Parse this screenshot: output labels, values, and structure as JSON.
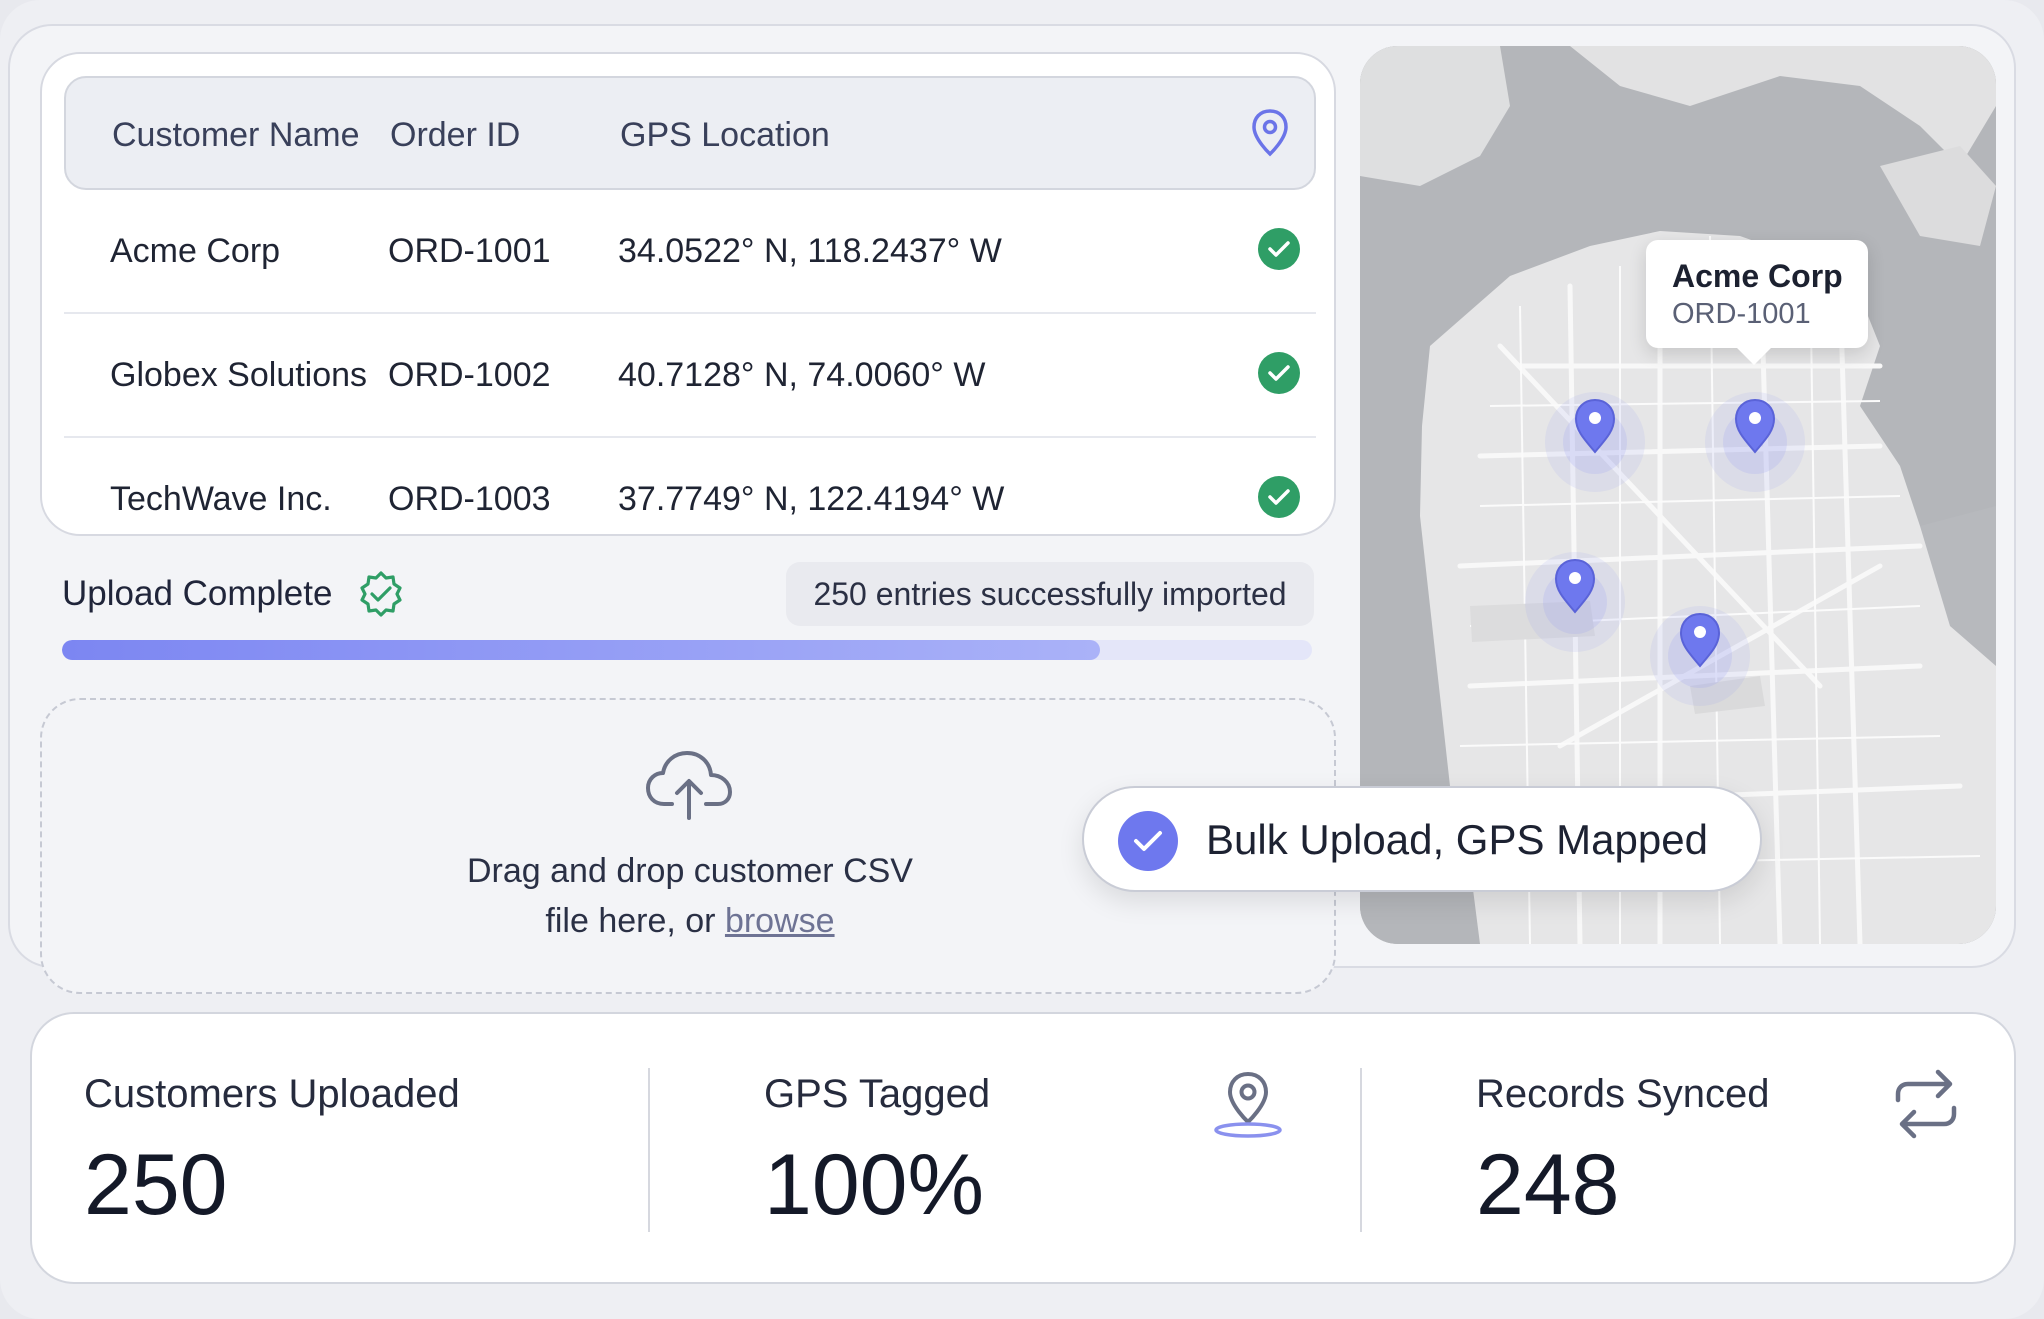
{
  "table": {
    "headers": {
      "customer": "Customer Name",
      "order": "Order ID",
      "gps": "GPS Location"
    },
    "header_icon": "map-pin-icon",
    "rows": [
      {
        "customer": "Acme Corp",
        "order": "ORD-1001",
        "gps": "34.0522° N, 118.2437° W",
        "status_icon": "check-circle-icon"
      },
      {
        "customer": "Globex Solutions",
        "order": "ORD-1002",
        "gps": "40.7128° N, 74.0060° W",
        "status_icon": "check-circle-icon"
      },
      {
        "customer": "TechWave Inc.",
        "order": "ORD-1003",
        "gps": "37.7749° N, 122.4194° W",
        "status_icon": "check-circle-icon"
      }
    ]
  },
  "upload": {
    "status_label": "Upload Complete",
    "status_icon": "verified-badge-icon",
    "imported_text": "250 entries successfully imported",
    "progress_fraction": 0.83
  },
  "dropzone": {
    "icon": "cloud-upload-icon",
    "line1": "Drag and drop customer CSV",
    "line2_prefix": "file here, or ",
    "browse_label": "browse"
  },
  "map": {
    "tooltip_title": "Acme Corp",
    "tooltip_subtitle": "ORD-1001",
    "marker_count": 4
  },
  "status_pill": {
    "text": "Bulk Upload, GPS Mapped",
    "icon": "check-circle-icon"
  },
  "stats": [
    {
      "label": "Customers Uploaded",
      "value": "250"
    },
    {
      "label": "GPS Tagged",
      "value": "100%",
      "icon": "location-pin-icon"
    },
    {
      "label": "Records Synced",
      "value": "248",
      "icon": "sync-arrows-icon"
    }
  ],
  "colors": {
    "accent": "#6e78ee",
    "success": "#2f9e66",
    "text": "#1f2433"
  }
}
